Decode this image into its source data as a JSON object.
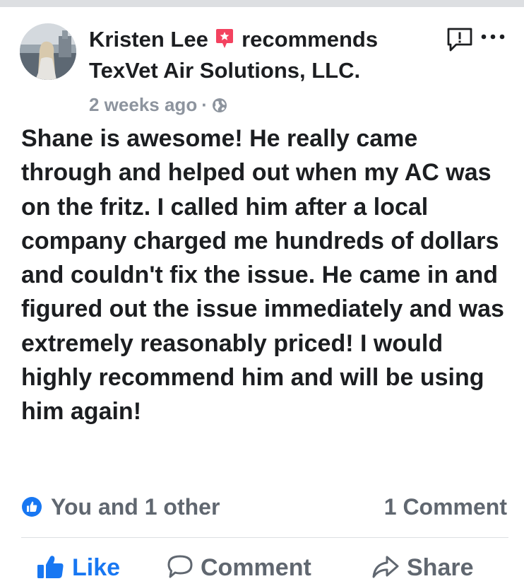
{
  "post": {
    "author": "Kristen Lee",
    "verb": "recommends",
    "page_name": "TexVet Air Solutions, LLC.",
    "timestamp": "2 weeks ago",
    "separator": "·",
    "audience_icon": "globe-icon",
    "body": "Shane is awesome! He really came through and helped out when my AC was on the fritz. I called him after a local company charged me hundreds of dollars and couldn't fix the issue. He came in and figured out the issue immediately and was extremely reasonably priced! I would highly recommend him and will be using him again!"
  },
  "reactions": {
    "icon": "like-badge-icon",
    "text": "You and 1 other",
    "comments": "1 Comment"
  },
  "actions": {
    "like": "Like",
    "comment": "Comment",
    "share": "Share"
  },
  "colors": {
    "brand_blue": "#1877f2",
    "recommend_red": "#f3425f",
    "secondary_text": "#606770",
    "meta_text": "#8d949e",
    "divider": "#dddfe2"
  }
}
